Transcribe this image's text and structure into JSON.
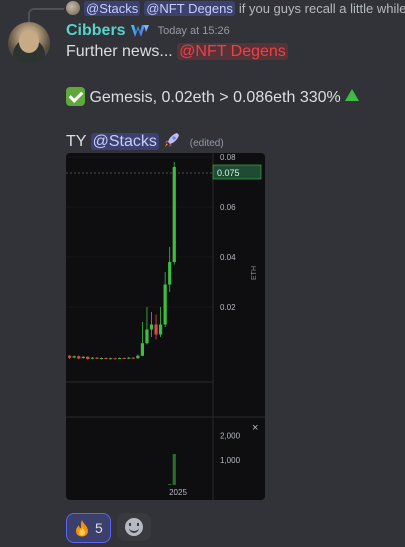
{
  "reply": {
    "author_mention": "@Stacks",
    "mention": "@NFT Degens",
    "preview": "if you guys recall a little while"
  },
  "message": {
    "username": "Cibbers",
    "timestamp": "Today at 15:26",
    "line1_text": "Further news... ",
    "line1_mention": "@NFT Degens",
    "line2_text": "Gemesis, 0.02eth > 0.086eth  330%",
    "line3_text": "TY ",
    "line3_mention": "@Stacks",
    "edited": "(edited)"
  },
  "reactions": [
    {
      "emoji": "fire",
      "count": "5"
    }
  ],
  "colors": {
    "username": "#58d3cc",
    "mention_red": "#f23f43",
    "up_candle": "#3fbc43",
    "down_candle": "#e2454b",
    "price_label_bg": "#1f4b34"
  },
  "chart_data": {
    "type": "candlestick",
    "price_axis_label": "ETH",
    "price_ticks": [
      "0.08",
      "0.06",
      "0.04",
      "0.02"
    ],
    "current_price_label": "0.075",
    "volume_ticks": [
      "2,000",
      "1,000"
    ],
    "x_label": "2025",
    "ylim": [
      -0.01,
      0.08
    ],
    "candles": [
      {
        "o": 0.0005,
        "c": -0.0003,
        "h": 0.0008,
        "l": -0.0008
      },
      {
        "o": -0.0002,
        "c": 0.0003,
        "h": 0.0006,
        "l": -0.0005
      },
      {
        "o": 0.0003,
        "c": -0.0006,
        "h": 0.0006,
        "l": -0.0009
      },
      {
        "o": -0.0004,
        "c": 0.0001,
        "h": 0.0003,
        "l": -0.0007
      },
      {
        "o": 0.0001,
        "c": -0.0008,
        "h": 0.0003,
        "l": -0.0011
      },
      {
        "o": -0.0006,
        "c": -0.0003,
        "h": 0.0,
        "l": -0.0009
      },
      {
        "o": -0.0003,
        "c": -0.0006,
        "h": 0.0,
        "l": -0.0008
      },
      {
        "o": -0.0006,
        "c": -0.0004,
        "h": -0.0002,
        "l": -0.0009
      },
      {
        "o": -0.0004,
        "c": -0.0007,
        "h": -0.0002,
        "l": -0.001
      },
      {
        "o": -0.0007,
        "c": -0.0005,
        "h": -0.0003,
        "l": -0.0009
      },
      {
        "o": -0.0005,
        "c": -0.0006,
        "h": -0.0003,
        "l": -0.0009
      },
      {
        "o": -0.0006,
        "c": -0.0004,
        "h": -0.0002,
        "l": -0.0008
      },
      {
        "o": -0.0004,
        "c": -0.0006,
        "h": -0.0002,
        "l": -0.0008
      },
      {
        "o": -0.0006,
        "c": -0.0003,
        "h": 0.0,
        "l": -0.0008
      },
      {
        "o": -0.0003,
        "c": -0.0005,
        "h": -0.0001,
        "l": -0.0007
      },
      {
        "o": -0.0005,
        "c": 0.0005,
        "h": 0.001,
        "l": -0.0007
      },
      {
        "o": 0.0005,
        "c": 0.0055,
        "h": 0.014,
        "l": 0.0003
      },
      {
        "o": 0.0055,
        "c": 0.011,
        "h": 0.02,
        "l": 0.005
      },
      {
        "o": 0.011,
        "c": 0.013,
        "h": 0.018,
        "l": 0.008
      },
      {
        "o": 0.013,
        "c": 0.009,
        "h": 0.017,
        "l": 0.007
      },
      {
        "o": 0.009,
        "c": 0.013,
        "h": 0.02,
        "l": 0.008
      },
      {
        "o": 0.013,
        "c": 0.029,
        "h": 0.034,
        "l": 0.012
      },
      {
        "o": 0.029,
        "c": 0.038,
        "h": 0.044,
        "l": 0.026
      },
      {
        "o": 0.038,
        "c": 0.076,
        "h": 0.078,
        "l": 0.037
      }
    ],
    "volumes": [
      0,
      0,
      0,
      0,
      0,
      0,
      0,
      0,
      0,
      0,
      0,
      0,
      0,
      0,
      0,
      0,
      0,
      0,
      0,
      0,
      0,
      0,
      40,
      1250
    ]
  }
}
